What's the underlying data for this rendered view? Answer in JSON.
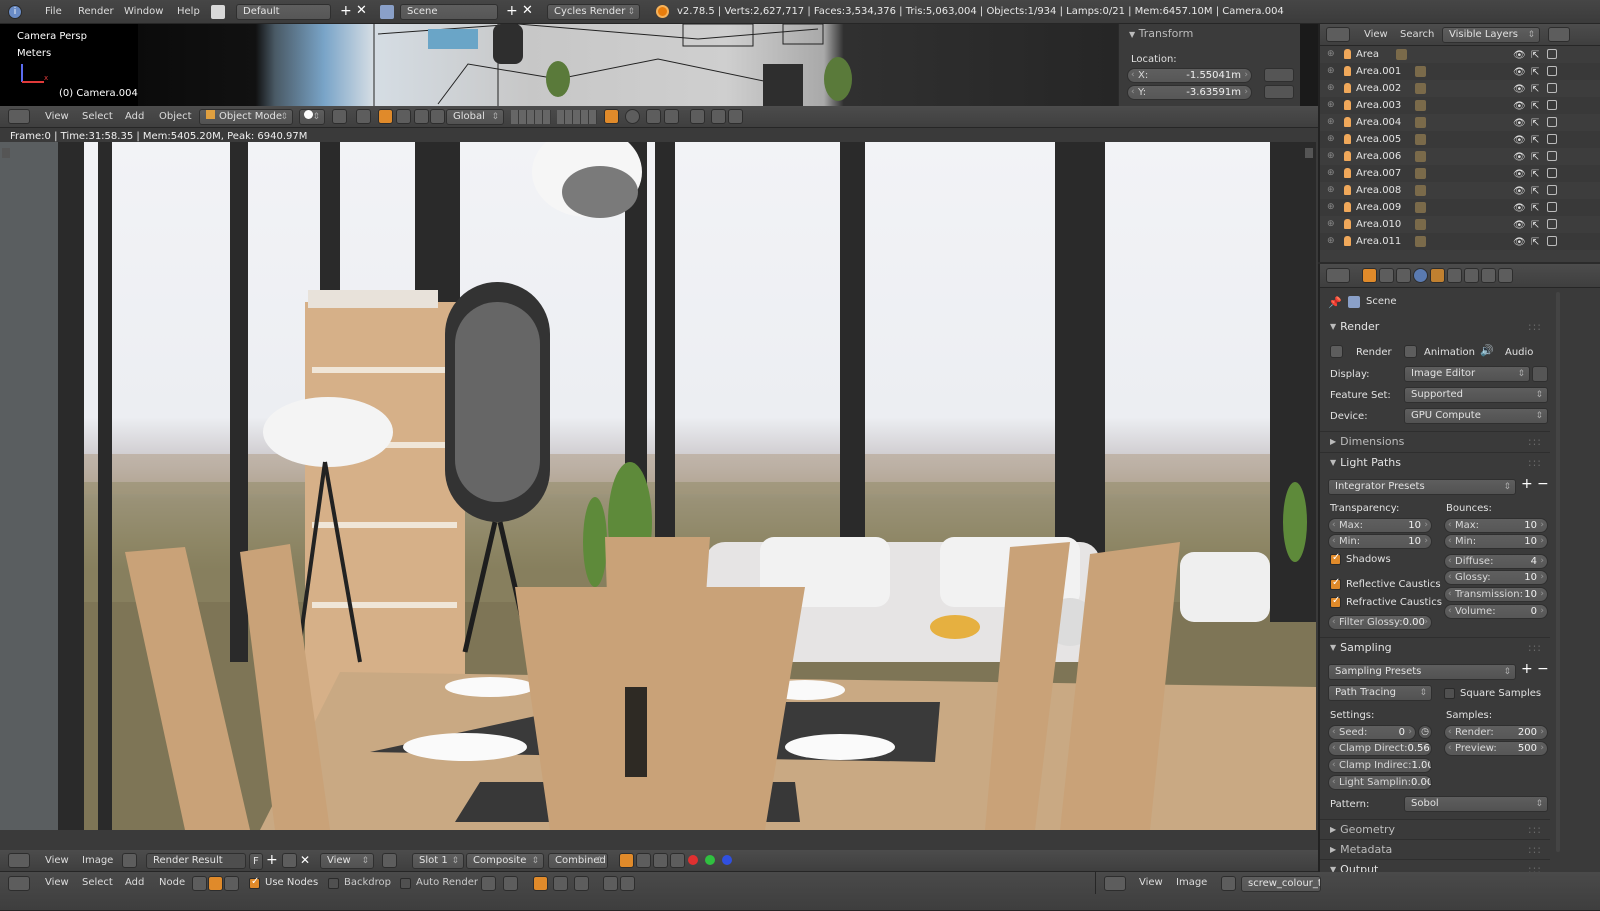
{
  "topbar": {
    "menus": [
      "File",
      "Render",
      "Window",
      "Help"
    ],
    "layout": "Default",
    "scene": "Scene",
    "engine": "Cycles Render",
    "stats": "v2.78.5 | Verts:2,627,717 | Faces:3,534,376 | Tris:5,063,004 | Objects:1/934 | Lamps:0/21 | Mem:6457.10M | Camera.004"
  },
  "viewport": {
    "camera_label": "Camera Persp",
    "units_label": "Meters",
    "object_label": "(0) Camera.004",
    "transform_title": "Transform",
    "location_label": "Location:",
    "x_label": "X:",
    "x_value": "-1.55041m",
    "y_label": "Y:",
    "y_value": "-3.63591m",
    "menus": [
      "View",
      "Select",
      "Add",
      "Object"
    ],
    "mode": "Object Mode",
    "orientation": "Global"
  },
  "render_view": {
    "info": "Frame:0 | Time:31:58.35 | Mem:5405.20M, Peak: 6940.97M"
  },
  "image_editor": {
    "menus": [
      "View",
      "Image"
    ],
    "image_name": "Render Result",
    "fake_user": "F",
    "view_menu": "View",
    "slot": "Slot 1",
    "pass": "Composite",
    "layer": "Combined"
  },
  "node_editor": {
    "menus": [
      "View",
      "Select",
      "Add",
      "Node"
    ],
    "use_nodes": "Use Nodes",
    "backdrop": "Backdrop",
    "auto_render": "Auto Render",
    "right_menus": [
      "View",
      "Image"
    ],
    "right_image": "screw_colour_te"
  },
  "outliner": {
    "menus": [
      "View",
      "Search"
    ],
    "filter": "Visible Layers",
    "items": [
      "Area",
      "Area.001",
      "Area.002",
      "Area.003",
      "Area.004",
      "Area.005",
      "Area.006",
      "Area.007",
      "Area.008",
      "Area.009",
      "Area.010",
      "Area.011"
    ]
  },
  "properties": {
    "scene_label": "Scene",
    "render_section": "Render",
    "render_btn": "Render",
    "animation_btn": "Animation",
    "audio_btn": "Audio",
    "display_label": "Display:",
    "display_value": "Image Editor",
    "feature_label": "Feature Set:",
    "feature_value": "Supported",
    "device_label": "Device:",
    "device_value": "GPU Compute",
    "dimensions_section": "Dimensions",
    "lightpaths_section": "Light Paths",
    "integrator_presets": "Integrator Presets",
    "transparency_label": "Transparency:",
    "bounces_label": "Bounces:",
    "t_max_label": "Max:",
    "t_max": "10",
    "t_min_label": "Min:",
    "t_min": "10",
    "b_max_label": "Max:",
    "b_max": "10",
    "b_min_label": "Min:",
    "b_min": "10",
    "shadows": "Shadows",
    "diffuse_label": "Diffuse:",
    "diffuse": "4",
    "glossy_label": "Glossy:",
    "glossy": "10",
    "transmission_label": "Transmission:",
    "transmission": "10",
    "volume_label": "Volume:",
    "volume": "0",
    "reflective_caustics": "Reflective Caustics",
    "refractive_caustics": "Refractive Caustics",
    "filter_glossy_label": "Filter Glossy:",
    "filter_glossy": "0.00",
    "sampling_section": "Sampling",
    "sampling_presets": "Sampling Presets",
    "path_tracing": "Path Tracing",
    "square_samples": "Square Samples",
    "settings_label": "Settings:",
    "samples_label": "Samples:",
    "seed_label": "Seed:",
    "seed": "0",
    "clamp_direct_label": "Clamp Direct:",
    "clamp_direct": "0.56",
    "clamp_indirect_label": "Clamp Indirec:",
    "clamp_indirect": "1.00",
    "light_sampling_label": "Light Samplin:",
    "light_sampling": "0.00",
    "render_samples_label": "Render:",
    "render_samples": "200",
    "preview_samples_label": "Preview:",
    "preview_samples": "500",
    "pattern_label": "Pattern:",
    "pattern_value": "Sobol",
    "geometry_section": "Geometry",
    "metadata_section": "Metadata",
    "output_section": "Output"
  },
  "colors": {
    "accent": "#e08a2a",
    "panel_bg": "#3a3a3a",
    "header_bg": "#454545",
    "field_bg": "#5a5a5a"
  }
}
